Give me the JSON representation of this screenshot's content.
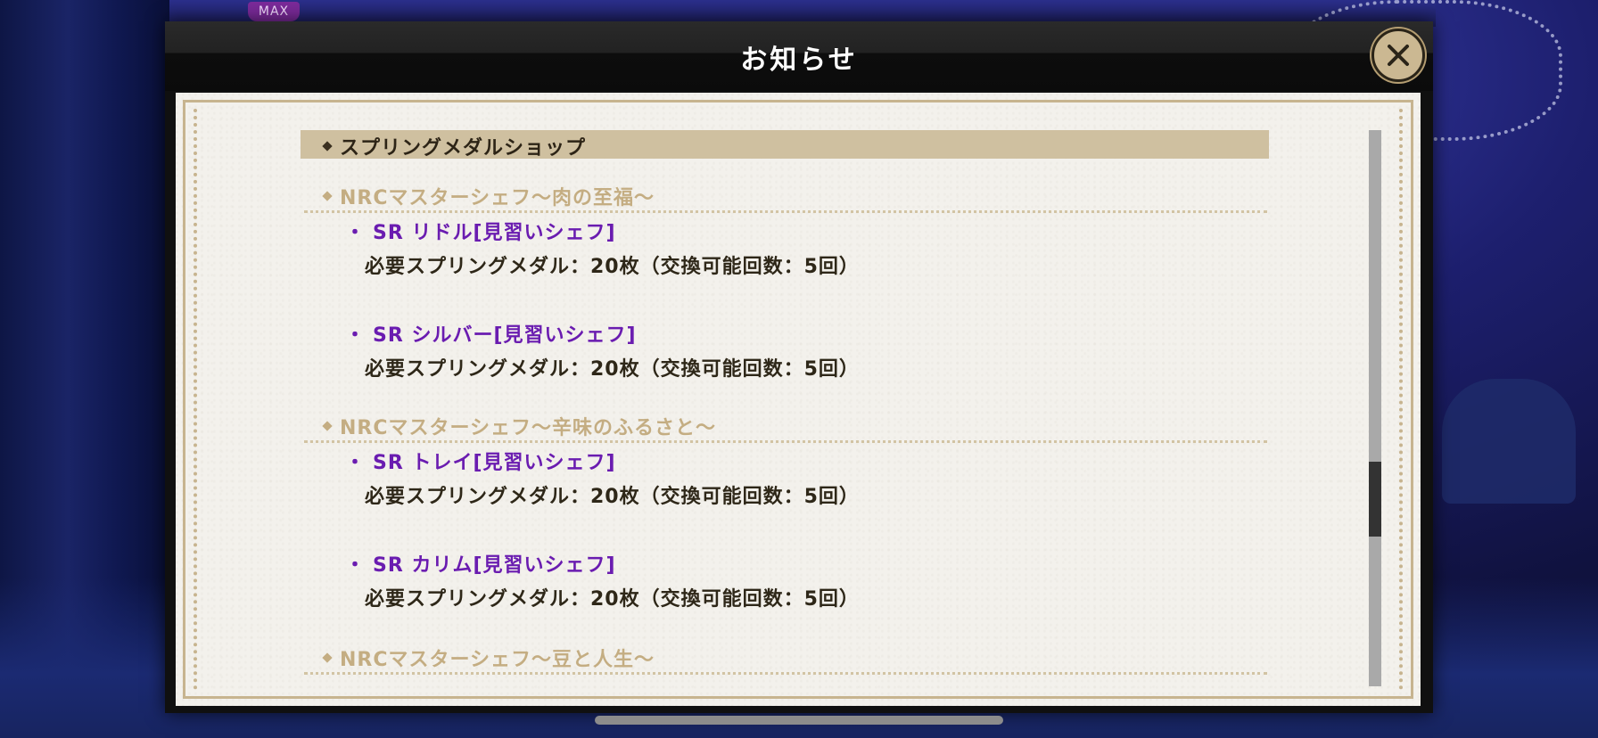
{
  "background": {
    "max_badge": "MAX"
  },
  "modal": {
    "title": "お知らせ",
    "close_icon": "close-icon",
    "section_heading": "スプリングメダルショップ",
    "groups": [
      {
        "heading": "NRCマスターシェフ〜肉の至福〜",
        "items": [
          {
            "name": "SR リドル[見習いシェフ]",
            "requirement": "必要スプリングメダル：20枚（交換可能回数：5回）"
          },
          {
            "name": "SR シルバー[見習いシェフ]",
            "requirement": "必要スプリングメダル：20枚（交換可能回数：5回）"
          }
        ]
      },
      {
        "heading": "NRCマスターシェフ〜辛味のふるさと〜",
        "items": [
          {
            "name": "SR トレイ[見習いシェフ]",
            "requirement": "必要スプリングメダル：20枚（交換可能回数：5回）"
          },
          {
            "name": "SR カリム[見習いシェフ]",
            "requirement": "必要スプリングメダル：20枚（交換可能回数：5回）"
          }
        ]
      },
      {
        "heading": "NRCマスターシェフ〜豆と人生〜",
        "items": []
      }
    ],
    "scroll_position": 0.6
  },
  "colors": {
    "section_bar": "#cfc0a0",
    "subhead": "#c4ad82",
    "item_name": "#6a1cb0",
    "close_button": "#cbb892"
  }
}
